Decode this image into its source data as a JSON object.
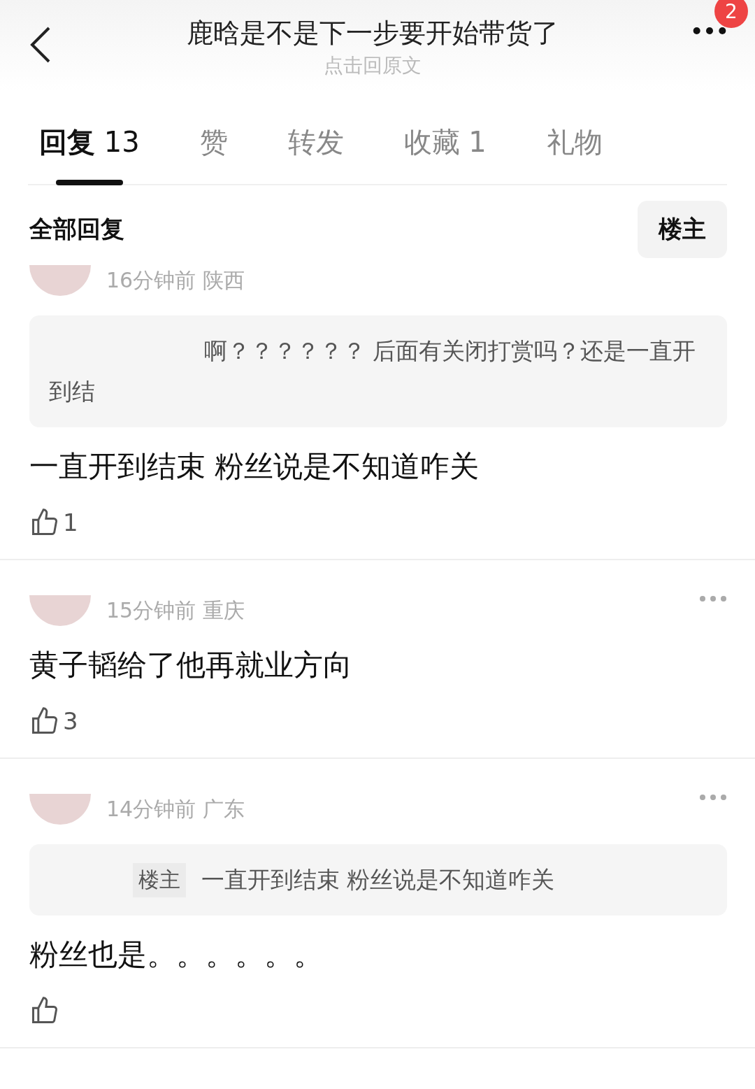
{
  "header": {
    "title": "鹿晗是不是下一步要开始带货了",
    "subtitle": "点击回原文",
    "badge": "2"
  },
  "tabs": [
    {
      "label": "回复",
      "count": "13",
      "selected": true
    },
    {
      "label": "赞",
      "selected": false
    },
    {
      "label": "转发",
      "selected": false
    },
    {
      "label": "收藏",
      "count": "1",
      "selected": false
    },
    {
      "label": "礼物",
      "selected": false
    }
  ],
  "section": {
    "title": "全部回复",
    "filter": "楼主"
  },
  "comments": [
    {
      "time": "16分钟前",
      "location": "陕西",
      "menu": false,
      "quote": {
        "text": "啊？？？？？？ 后面有关闭打赏吗？还是一直开到结"
      },
      "body": "一直开到结束 粉丝说是不知道咋关",
      "likes": "1"
    },
    {
      "time": "15分钟前",
      "location": "重庆",
      "menu": true,
      "body": "黄子韬给了他再就业方向",
      "likes": "3"
    },
    {
      "time": "14分钟前",
      "location": "广东",
      "menu": true,
      "quote": {
        "tag": "楼主",
        "text": "一直开到结束 粉丝说是不知道咋关"
      },
      "body": "粉丝也是。。。。。。"
    }
  ]
}
